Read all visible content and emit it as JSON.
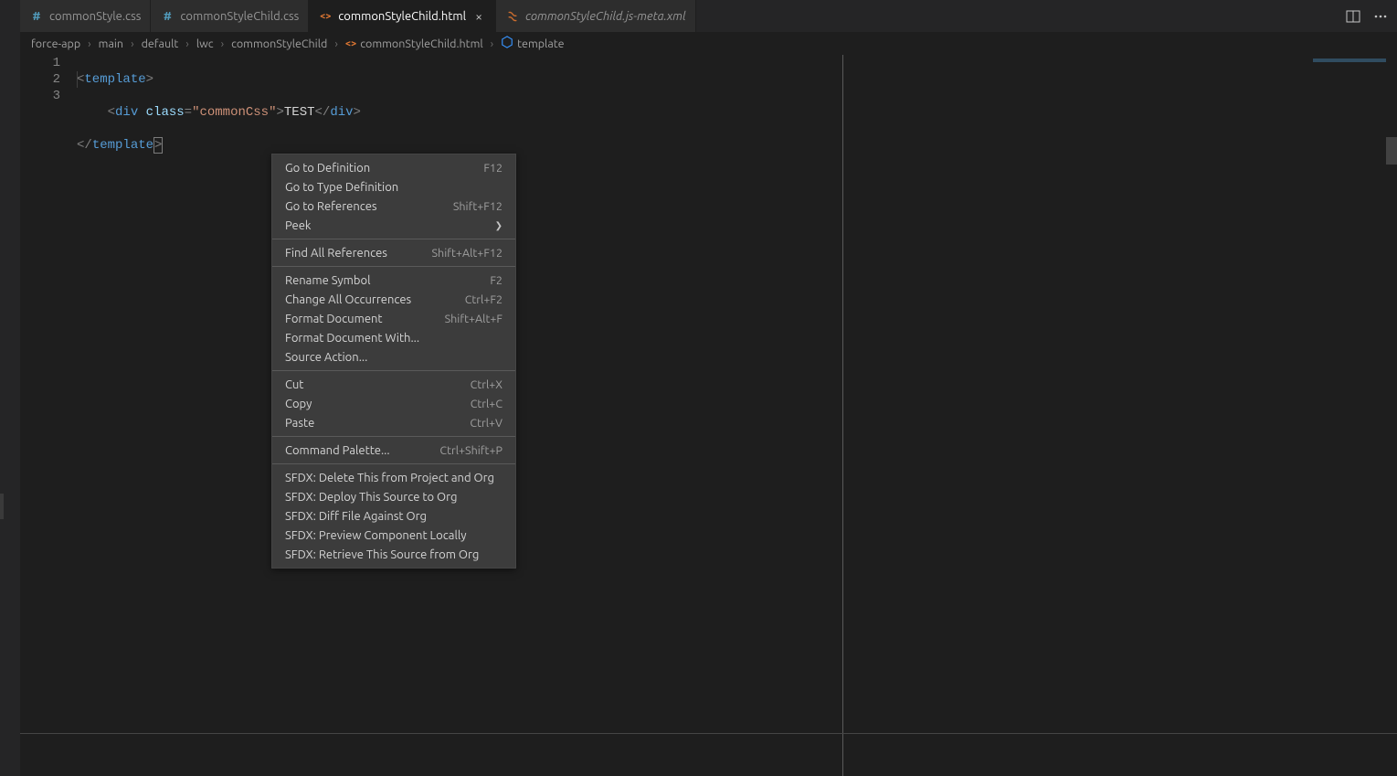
{
  "tabs": [
    {
      "label": "commonStyle.css",
      "type": "css",
      "active": false,
      "italic": false
    },
    {
      "label": "commonStyleChild.css",
      "type": "css",
      "active": false,
      "italic": false
    },
    {
      "label": "commonStyleChild.html",
      "type": "html",
      "active": true,
      "italic": false
    },
    {
      "label": "commonStyleChild.js-meta.xml",
      "type": "xml",
      "active": false,
      "italic": true
    }
  ],
  "breadcrumbs": {
    "parts": [
      "force-app",
      "main",
      "default",
      "lwc",
      "commonStyleChild"
    ],
    "file": "commonStyleChild.html",
    "symbol": "template"
  },
  "code": {
    "lines": [
      "1",
      "2",
      "3"
    ],
    "l1": {
      "open": "<",
      "tag": "template",
      "close": ">"
    },
    "l2": {
      "open1": "<",
      "tag1": "div",
      "sp": " ",
      "attr": "class",
      "eq": "=",
      "str": "\"commonCss\"",
      "close1": ">",
      "text": "TEST",
      "open2": "</",
      "tag2": "div",
      "close2": ">"
    },
    "l3": {
      "open": "</",
      "tag": "template",
      "close": ">"
    }
  },
  "contextMenu": {
    "groups": [
      [
        {
          "label": "Go to Definition",
          "shortcut": "F12"
        },
        {
          "label": "Go to Type Definition",
          "shortcut": ""
        },
        {
          "label": "Go to References",
          "shortcut": "Shift+F12"
        },
        {
          "label": "Peek",
          "shortcut": "",
          "submenu": true
        }
      ],
      [
        {
          "label": "Find All References",
          "shortcut": "Shift+Alt+F12"
        }
      ],
      [
        {
          "label": "Rename Symbol",
          "shortcut": "F2"
        },
        {
          "label": "Change All Occurrences",
          "shortcut": "Ctrl+F2"
        },
        {
          "label": "Format Document",
          "shortcut": "Shift+Alt+F"
        },
        {
          "label": "Format Document With...",
          "shortcut": ""
        },
        {
          "label": "Source Action...",
          "shortcut": ""
        }
      ],
      [
        {
          "label": "Cut",
          "shortcut": "Ctrl+X"
        },
        {
          "label": "Copy",
          "shortcut": "Ctrl+C"
        },
        {
          "label": "Paste",
          "shortcut": "Ctrl+V"
        }
      ],
      [
        {
          "label": "Command Palette...",
          "shortcut": "Ctrl+Shift+P"
        }
      ],
      [
        {
          "label": "SFDX: Delete This from Project and Org",
          "shortcut": ""
        },
        {
          "label": "SFDX: Deploy This Source to Org",
          "shortcut": ""
        },
        {
          "label": "SFDX: Diff File Against Org",
          "shortcut": ""
        },
        {
          "label": "SFDX: Preview Component Locally",
          "shortcut": ""
        },
        {
          "label": "SFDX: Retrieve This Source from Org",
          "shortcut": ""
        }
      ]
    ]
  },
  "icons": {
    "css": "#",
    "html": "<>",
    "xml": "§",
    "template": "⬡"
  },
  "colors": {
    "cssIcon": "#519aba",
    "htmlIcon": "#e37933",
    "xmlIcon": "#cc6d2e",
    "templateIcon": "#3794ff"
  }
}
